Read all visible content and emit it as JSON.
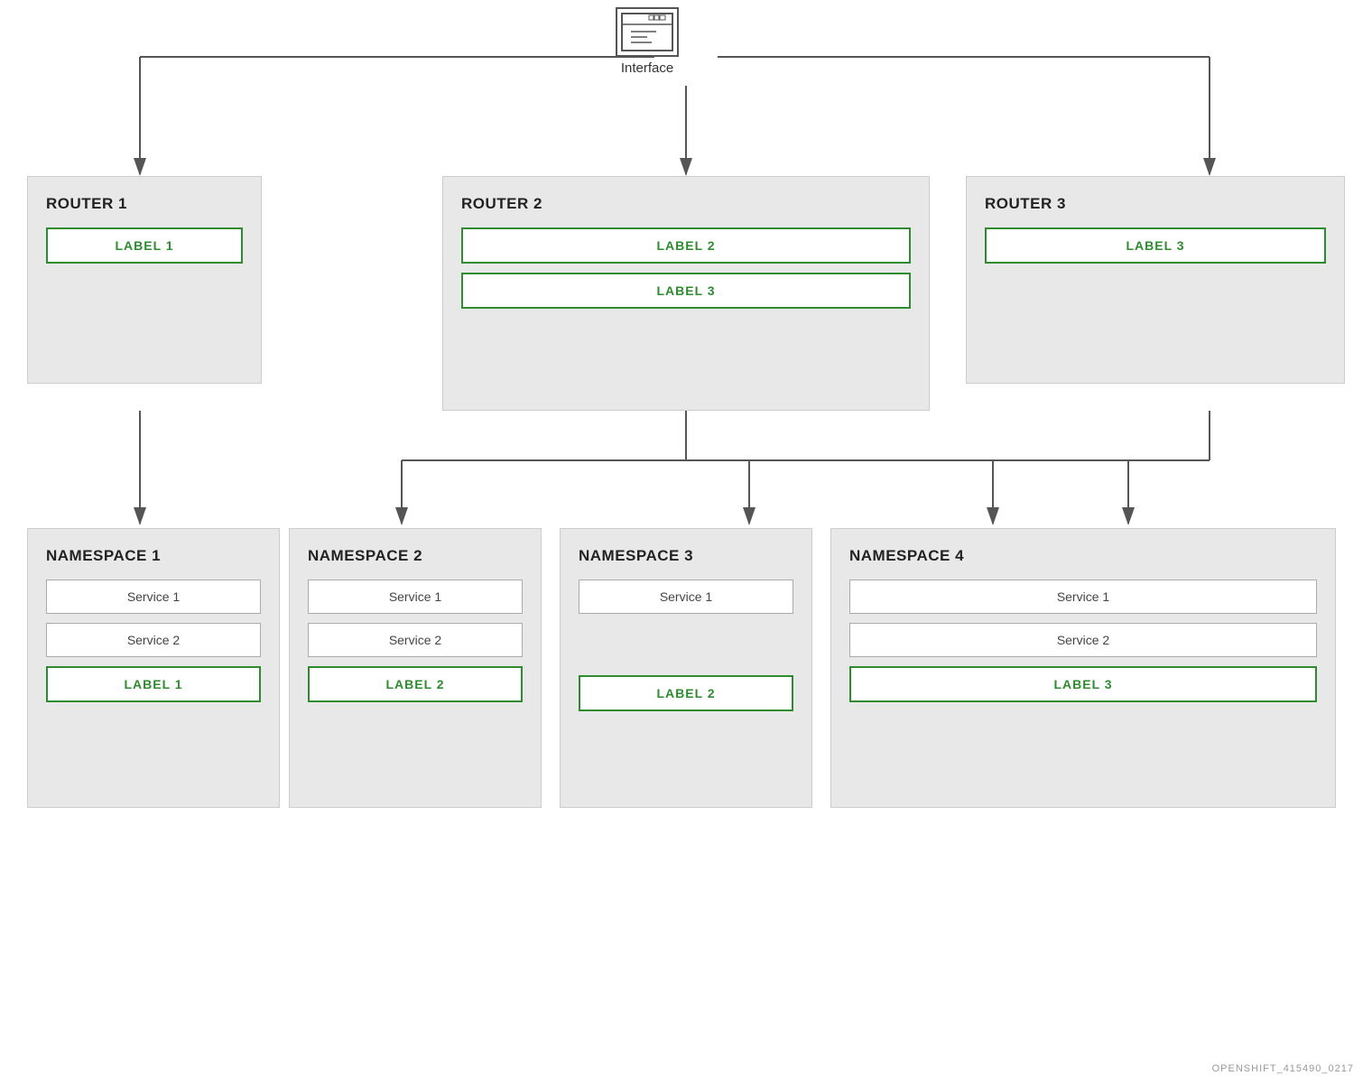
{
  "interface": {
    "label": "Interface"
  },
  "routers": [
    {
      "id": "router1",
      "title": "ROUTER 1",
      "labels": [
        "LABEL 1"
      ]
    },
    {
      "id": "router2",
      "title": "ROUTER 2",
      "labels": [
        "LABEL 2",
        "LABEL 3"
      ]
    },
    {
      "id": "router3",
      "title": "ROUTER 3",
      "labels": [
        "LABEL 3"
      ]
    }
  ],
  "namespaces": [
    {
      "id": "ns1",
      "title": "NAMESPACE 1",
      "services": [
        "Service 1",
        "Service 2"
      ],
      "label": "LABEL 1"
    },
    {
      "id": "ns2",
      "title": "NAMESPACE 2",
      "services": [
        "Service 1",
        "Service 2"
      ],
      "label": "LABEL 2"
    },
    {
      "id": "ns3",
      "title": "NAMESPACE 3",
      "services": [
        "Service 1"
      ],
      "label": "LABEL 2"
    },
    {
      "id": "ns4",
      "title": "NAMESPACE 4",
      "services": [
        "Service 1",
        "Service 2"
      ],
      "label": "LABEL 3"
    }
  ],
  "watermark": "OPENSHIFT_415490_0217"
}
